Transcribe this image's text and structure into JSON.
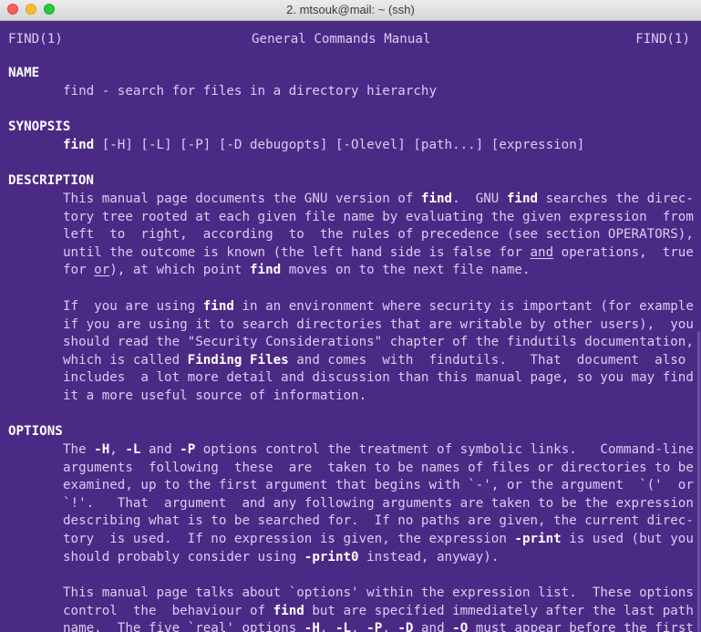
{
  "window": {
    "title": "2. mtsouk@mail: ~ (ssh)"
  },
  "man": {
    "header_left": "FIND(1)",
    "header_center": "General Commands Manual",
    "header_right": "FIND(1)",
    "name_heading": "NAME",
    "name_text": "find - search for files in a directory hierarchy",
    "synopsis_heading": "SYNOPSIS",
    "synopsis_cmd": "find",
    "synopsis_args": " [-H] [-L] [-P] [-D debugopts] [-Olevel] [path...] [expression]",
    "description_heading": "DESCRIPTION",
    "options_heading": "OPTIONS",
    "d1": [
      [
        "This manual page documents the GNU version of ",
        "find",
        ".  GNU ",
        "find",
        " searches the direc-"
      ],
      [
        "tory tree rooted at each given file name by evaluating the given expression  from"
      ],
      [
        "left  to  right,  according  to  the rules of precedence (see section OPERATORS),"
      ],
      [
        "until the outcome is known (the left hand side is false for ",
        "and",
        " operations,  true"
      ],
      [
        "for ",
        "or",
        "), at which point ",
        "find",
        " moves on to the next file name."
      ]
    ],
    "d2": [
      [
        "If  you are using ",
        "find",
        " in an environment where security is important (for example"
      ],
      [
        "if you are using it to search directories that are writable by other users),  you"
      ],
      [
        "should read the \"Security Considerations\" chapter of the findutils documentation,"
      ],
      [
        "which is called ",
        "Finding Files",
        " and comes  with  findutils.   That  document  also"
      ],
      [
        "includes  a lot more detail and discussion than this manual page, so you may find"
      ],
      [
        "it a more useful source of information."
      ]
    ],
    "o1": [
      [
        "The ",
        "-H",
        ", ",
        "-L",
        " and ",
        "-P",
        " options control the treatment of symbolic links.   Command-line"
      ],
      [
        "arguments  following  these  are  taken to be names of files or directories to be"
      ],
      [
        "examined, up to the first argument that begins with `-', or the argument  `('  or"
      ],
      [
        "`!'.   That  argument  and any following arguments are taken to be the expression"
      ],
      [
        "describing what is to be searched for.  If no paths are given, the current direc-"
      ],
      [
        "tory  is used.  If no expression is given, the expression ",
        "-print",
        " is used (but you"
      ],
      [
        "should probably consider using ",
        "-print0",
        " instead, anyway)."
      ]
    ],
    "o2": [
      [
        "This manual page talks about `options' within the expression list.  These options"
      ],
      [
        "control  the  behaviour of ",
        "find",
        " but are specified immediately after the last path"
      ],
      [
        "name.  The five `real' options ",
        "-H",
        ", ",
        "-L",
        ", ",
        "-P",
        ", ",
        "-D",
        " and ",
        "-O",
        " must appear before the first"
      ]
    ]
  }
}
